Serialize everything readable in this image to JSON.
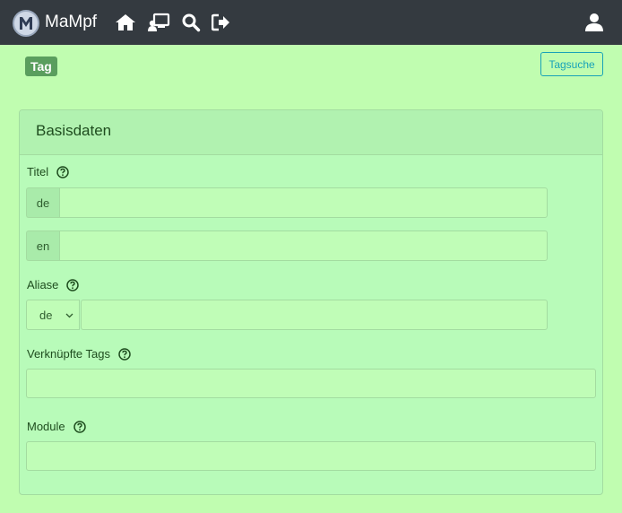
{
  "navbar": {
    "brand": "MaMpf",
    "icons": [
      "home-icon",
      "lecture-icon",
      "search-icon",
      "logout-icon"
    ],
    "user_icon": "user-icon"
  },
  "page": {
    "badge": "Tag",
    "search_button": "Tagsuche"
  },
  "card": {
    "title": "Basisdaten",
    "fields": {
      "titel_label": "Titel",
      "lang_de": "de",
      "lang_en": "en",
      "titel_de_value": "",
      "titel_en_value": "",
      "aliase_label": "Aliase",
      "aliase_select": "de",
      "aliase_value": "",
      "linked_tags_label": "Verknüpfte Tags",
      "linked_tags_value": "",
      "module_label": "Module",
      "module_value": ""
    }
  },
  "colors": {
    "navbar": "#343a40",
    "background": "#c0fdb0",
    "badge": "#5a9e5e",
    "info": "#17a2b8"
  }
}
